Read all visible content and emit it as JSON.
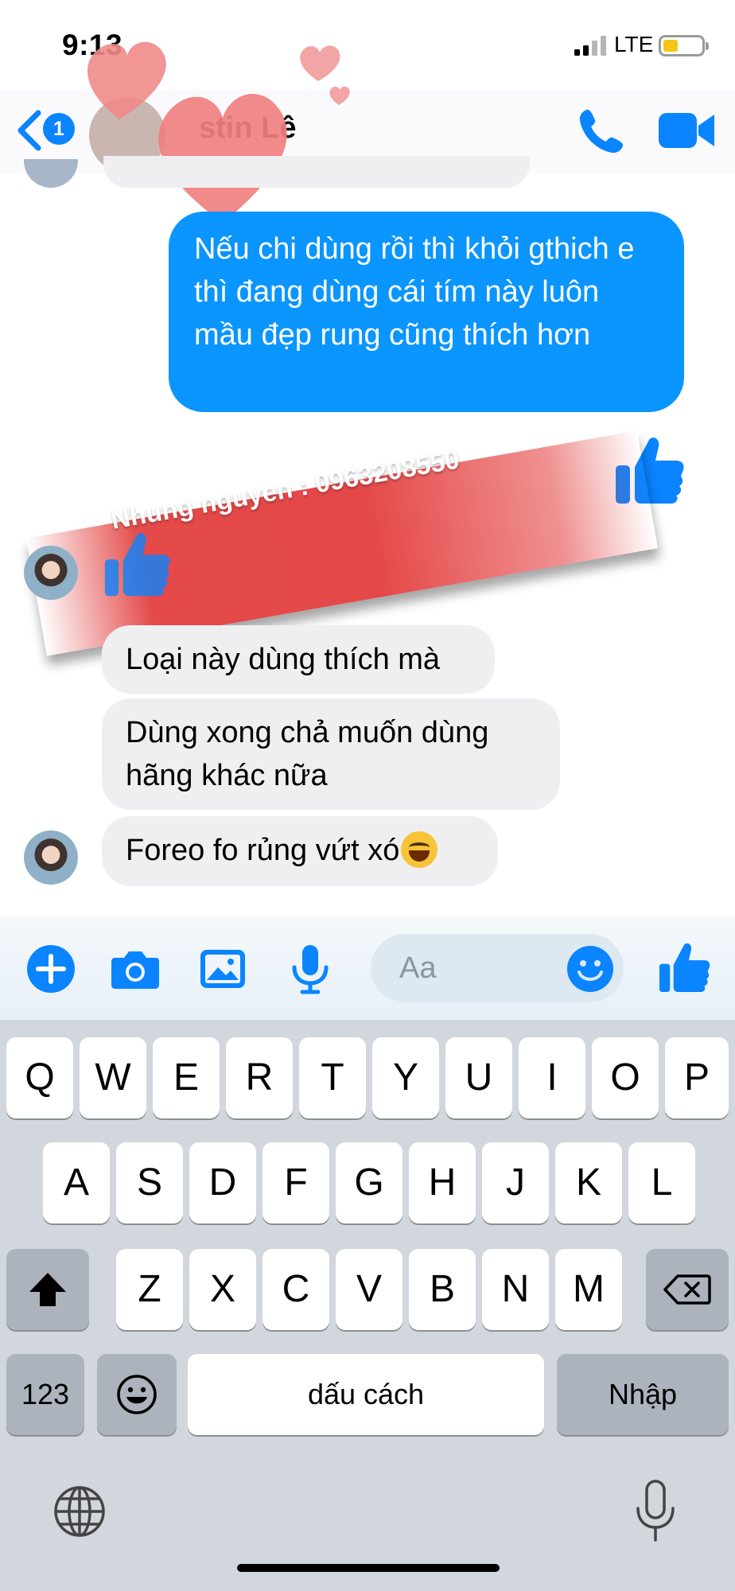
{
  "status": {
    "time": "9:13",
    "network": "LTE"
  },
  "header": {
    "unread_count": "1",
    "contact_name": "stin Lê"
  },
  "icons": {
    "back": "chevron-left-icon",
    "call": "phone-icon",
    "video": "video-camera-icon",
    "like": "thumbs-up-icon",
    "hearts": "heart-sticker-icon"
  },
  "messages": [
    {
      "direction": "outgoing",
      "text": "Nếu chi dùng rồi thì khỏi gthich e thì đang dùng cái tím này luôn mầu đẹp rung cũng thích hơn"
    },
    {
      "direction": "incoming",
      "text": "Loại này dùng thích mà"
    },
    {
      "direction": "incoming",
      "text": "Dùng xong chả muốn dùng hãng khác nữa"
    },
    {
      "direction": "incoming",
      "text": "Foreo fo rủng vứt xó",
      "emoji": "grinning-squinting-face"
    }
  ],
  "watermark": {
    "text": "Nhung nguyen : 0963208550"
  },
  "composer": {
    "placeholder": "Aa"
  },
  "keyboard": {
    "row1": [
      "Q",
      "W",
      "E",
      "R",
      "T",
      "Y",
      "U",
      "I",
      "O",
      "P"
    ],
    "row2": [
      "A",
      "S",
      "D",
      "F",
      "G",
      "H",
      "J",
      "K",
      "L"
    ],
    "row3": [
      "Z",
      "X",
      "C",
      "V",
      "B",
      "N",
      "M"
    ],
    "numbers_label": "123",
    "space_label": "dấu cách",
    "return_label": "Nhập"
  },
  "colors": {
    "accent": "#0a84ff",
    "outgoing_bubble": "#0a95ff",
    "incoming_bubble": "#efeff1",
    "watermark": "#e54848"
  }
}
